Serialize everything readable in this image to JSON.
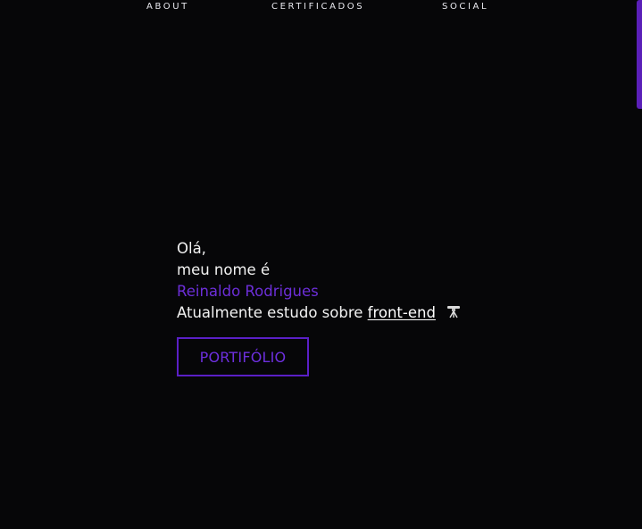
{
  "nav": {
    "items": [
      {
        "label": "ABOUT"
      },
      {
        "label": "CERTIFICADOS"
      },
      {
        "label": "SOCIAL"
      }
    ]
  },
  "hero": {
    "greeting": "Olá,",
    "intro": "meu nome é",
    "name": "Reinaldo Rodrigues",
    "study_prefix": "Atualmente estudo sobre ",
    "study_link": "front-end",
    "study_icon": "telescope-icon",
    "button_label": "PORTIFÓLIO"
  },
  "colors": {
    "background": "#060608",
    "accent": "#6c2ed8",
    "text": "#f2f2f2"
  }
}
